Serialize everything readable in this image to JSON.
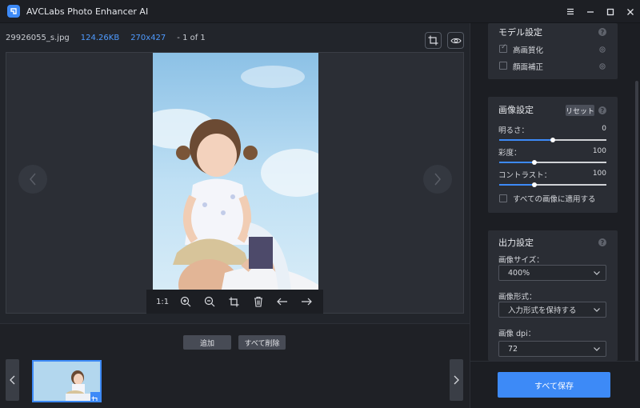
{
  "window": {
    "title": "AVCLabs Photo Enhancer AI",
    "controls": [
      "menu-icon",
      "minimize-icon",
      "maximize-icon",
      "close-icon"
    ]
  },
  "file_info": {
    "name": "29926055_s.jpg",
    "size": "124.26KB",
    "dimensions": "270x427",
    "count": "- 1 of 1"
  },
  "toolbar": {
    "ratio_label": "1:1",
    "icons": [
      "zoom-in-icon",
      "zoom-out-icon",
      "crop-icon",
      "trash-icon",
      "arrow-left-icon",
      "arrow-right-icon"
    ]
  },
  "actions": {
    "add_label": "追加",
    "delete_all_label": "すべて削除"
  },
  "model_settings": {
    "title": "モデル設定",
    "items": [
      {
        "label": "高画質化",
        "checked": true
      },
      {
        "label": "顔面補正",
        "checked": false
      }
    ]
  },
  "image_settings": {
    "title": "画像設定",
    "reset_label": "リセット",
    "sliders": [
      {
        "label": "明るさ：",
        "value": "0",
        "level": 0.5
      },
      {
        "label": "彩度：",
        "value": "100",
        "level": 0.33
      },
      {
        "label": "コントラスト：",
        "value": "100",
        "level": 0.33
      }
    ],
    "apply_all_label": "すべての画像に適用する"
  },
  "output_settings": {
    "title": "出力設定",
    "image_size_label": "画像サイズ：",
    "image_size_value": "400%",
    "format_label": "画像形式：",
    "format_value": "入力形式を保持する",
    "dpi_label": "画像 dpi：",
    "dpi_value": "72"
  },
  "save_all_label": "すべて保存",
  "colors": {
    "accent": "#3d8af7",
    "background": "#22252b",
    "panel": "#2a2d34"
  }
}
